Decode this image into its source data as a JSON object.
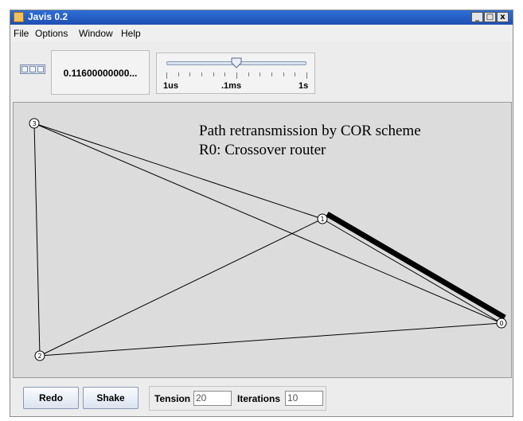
{
  "window": {
    "title": "Javis 0.2",
    "buttons": [
      "_",
      "□",
      "x"
    ]
  },
  "menu": [
    "File",
    "Options",
    "Window",
    "Help"
  ],
  "toolbar": {
    "time_value": "0.11600000000...",
    "slider": {
      "labels": [
        "1us",
        ".1ms",
        "1s"
      ],
      "position_fraction": 0.5
    }
  },
  "canvas": {
    "annotation_line1": "Path retransmission by COR scheme",
    "annotation_line2": "R0: Crossover router",
    "nodes": [
      {
        "id": "0"
      },
      {
        "id": "1"
      },
      {
        "id": "2"
      },
      {
        "id": "3"
      }
    ],
    "edges": [
      [
        "3",
        "1"
      ],
      [
        "3",
        "0"
      ],
      [
        "3",
        "2"
      ],
      [
        "2",
        "1"
      ],
      [
        "2",
        "0"
      ],
      [
        "1",
        "0"
      ]
    ],
    "highlighted_edge": [
      "1",
      "0"
    ]
  },
  "controls": {
    "redo_label": "Redo",
    "shake_label": "Shake",
    "tension_label": "Tension",
    "tension_value": "20",
    "iterations_label": "Iterations",
    "iterations_value": "10"
  }
}
